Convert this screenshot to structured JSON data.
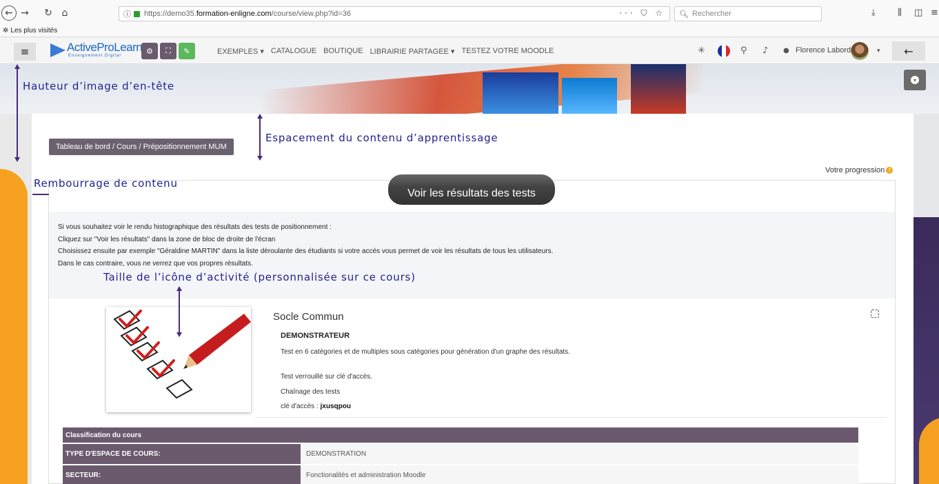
{
  "browser": {
    "url_prefix": "https://demo35.",
    "url_domain": "formation-enligne.com",
    "url_path": "/course/view.php?id=36",
    "search_placeholder": "Rechercher",
    "bookmarks_label": "Les plus visités"
  },
  "navbar": {
    "logo_text": "ActiveProLearn",
    "logo_subtitle": "Enseignement Digital",
    "menu": [
      "EXEMPLES ▾",
      "CATALOGUE",
      "BOUTIQUE",
      "LIBRAIRIE PARTAGEE ▾",
      "TESTEZ VOTRE MOODLE"
    ],
    "user_name": "Florence Labord",
    "colors": {
      "btn_dark": "#6b5a6e",
      "btn_green": "#5cb85c"
    }
  },
  "breadcrumb": "Tableau de bord  /  Cours  /  Prépositionnement MUM",
  "progress_label": "Votre progression",
  "section": {
    "title": "Voir les résultats des tests",
    "intro": [
      "Si vous souhaitez voir le rendu histographique des résultats des tests de positionnement :",
      "Cliquez sur \"Voir les résultats\" dans la zone de bloc de  droite de l'écran",
      "Choisissez ensuite par exemple  \"Géraldine MARTIN\" dans la liste déroulante des étudiants si votre accès vous permet de voir les résultats de tous les utilisateurs.",
      "Dans le cas contraire, vous ne verrez que vos propres résultats."
    ]
  },
  "activity": {
    "title": "Socle Commun",
    "subtitle": "DEMONSTRATEUR",
    "desc": "Test en 6 catégories et de multiples sous catégories pour génération d'un graphe des résultats.",
    "p2": "Test verrouillé sur clé d'accès.",
    "p3": "Chaînage des tests",
    "key_label": "clé d'accès : ",
    "key_value": "jxusqpou"
  },
  "table": {
    "header": "Classification du cours",
    "rows": [
      {
        "key": "TYPE D'ESPACE DE COURS:",
        "value": "DEMONSTRATION"
      },
      {
        "key": "SECTEUR:",
        "value": "Fonctionalités et administration Moodle"
      }
    ]
  },
  "annotations": {
    "header_height": "Hauteur d’image d’en-tête",
    "content_spacing": "Espacement du contenu d’apprentissage",
    "content_padding": "Rembourrage de contenu",
    "activity_icon": "Taille de l’icône d’activité (personnalisée sur ce cours)"
  }
}
